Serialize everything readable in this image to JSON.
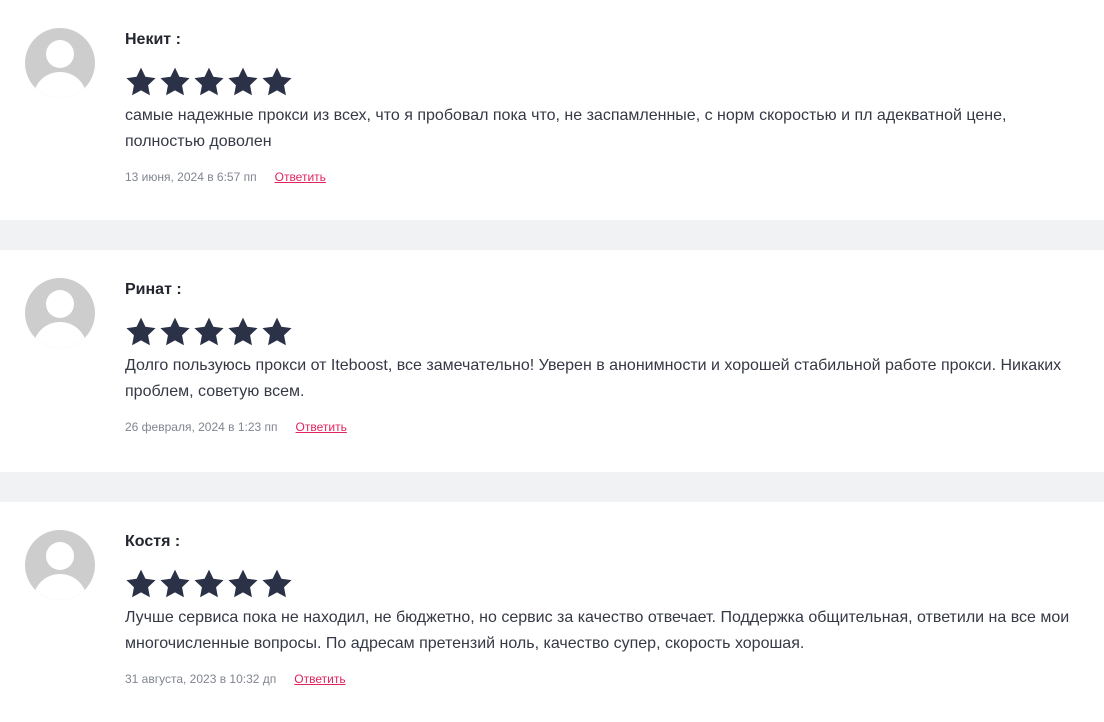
{
  "reviews": [
    {
      "author": "Некит :",
      "rating": 5,
      "text": "самые надежные прокси из всех, что я пробовал пока что, не заспамленные, с норм скоростью и пл адекватной цене, полностью доволен",
      "date": "13 июня, 2024 в 6:57 пп",
      "reply_label": "Ответить"
    },
    {
      "author": "Ринат :",
      "rating": 5,
      "text": "Долго пользуюсь прокси от Iteboost, все замечательно! Уверен в анонимности и хорошей стабильной работе прокси. Никаких проблем, советую всем.",
      "date": "26 февраля, 2024 в 1:23 пп",
      "reply_label": "Ответить"
    },
    {
      "author": "Костя :",
      "rating": 5,
      "text": "Лучше сервиса пока не находил, не бюджетно, но сервис за качество отвечает. Поддержка общительная, ответили на все мои многочисленные вопросы. По адресам претензий ноль, качество супер, скорость хорошая.",
      "date": "31 августа, 2023 в 10:32 дп",
      "reply_label": "Ответить"
    }
  ],
  "colors": {
    "star": "#2b3146",
    "reply_link": "#e0245e",
    "separator": "#f1f2f4",
    "avatar": "#cdcdcd"
  },
  "icons": {
    "avatar": "default-user-avatar-icon",
    "star": "star-icon"
  }
}
